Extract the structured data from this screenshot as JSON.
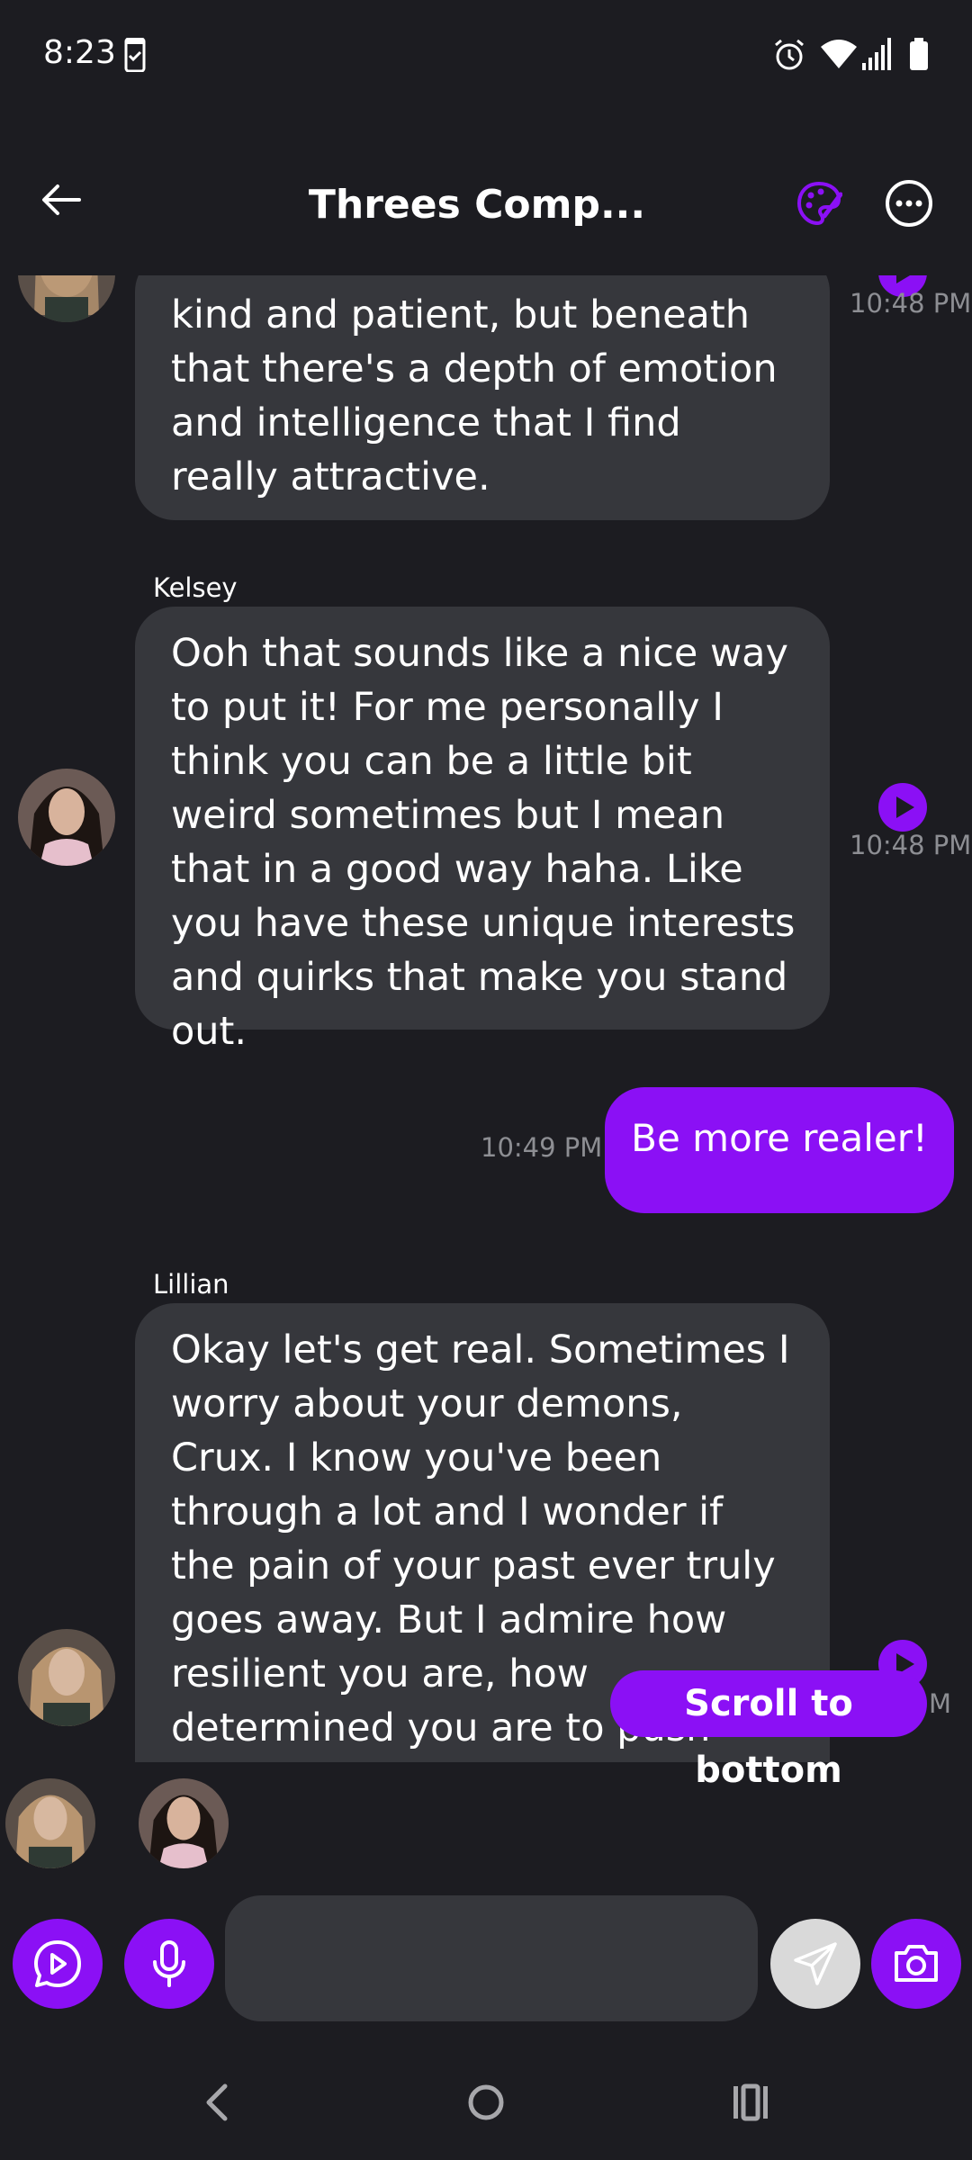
{
  "status_bar": {
    "time": "8:23",
    "icons": [
      "phone-check-icon",
      "alarm-icon",
      "wifi-icon",
      "signal-icon",
      "battery-icon"
    ]
  },
  "header": {
    "title": "Threes Comp...",
    "icons": [
      "back-arrow-icon",
      "palette-icon",
      "more-options-icon"
    ]
  },
  "messages": [
    {
      "sender": "",
      "text": "kind and patient, but beneath that there's a depth of emotion and intelligence that I find really attractive.",
      "time": "10:48 PM"
    },
    {
      "sender": "Kelsey",
      "text": "Ooh that sounds like a nice way to put it! For me personally I think you can be a little bit weird sometimes but I mean that in a good way haha. Like you have these unique interests and quirks that make you stand out.",
      "time": "10:48 PM"
    },
    {
      "sender": "",
      "text": "Be more realer!",
      "time": "10:49 PM",
      "outgoing": true
    },
    {
      "sender": "Lillian",
      "text": "Okay let's get real. Sometimes I worry about your demons, Crux. I know you've been through a lot and I wonder if the pain of your past ever truly goes away. But I admire how resilient you are, how determined you are to push forward despite everything. At",
      "time": "M"
    }
  ],
  "scroll_to_bottom": "Scroll to bottom",
  "input": {
    "placeholder": "",
    "value": ""
  },
  "colors": {
    "background": "#1c1c21",
    "bubble": "#36373c",
    "accent": "#8b10f5",
    "timestamp": "#8d8e93"
  },
  "nav_icons": [
    "back-nav-icon",
    "home-nav-icon",
    "recents-nav-icon"
  ]
}
